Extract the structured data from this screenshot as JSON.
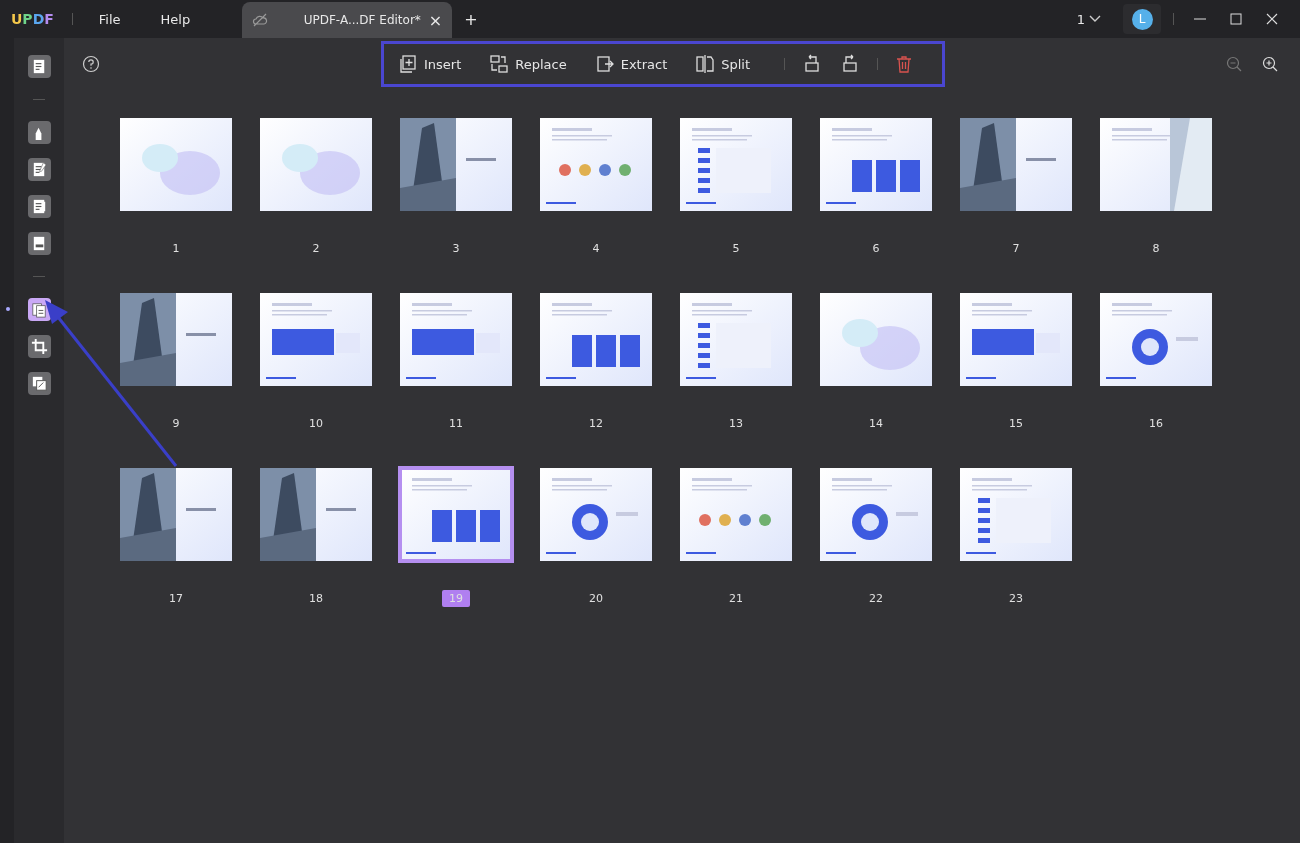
{
  "app": {
    "logo": "UPDF",
    "menu": [
      "File",
      "Help"
    ]
  },
  "tab": {
    "title": "UPDF-A...DF Editor*",
    "close": "×",
    "add": "+"
  },
  "window_controls": {
    "page_count": "1",
    "avatar": "L"
  },
  "sidebar": {
    "groups": [
      [
        {
          "kind": "reader",
          "selected": false
        }
      ],
      [
        {
          "kind": "comment",
          "selected": false
        },
        {
          "kind": "edit",
          "selected": false
        },
        {
          "kind": "form",
          "selected": false
        },
        {
          "kind": "fill",
          "selected": false
        }
      ],
      [
        {
          "kind": "organize",
          "selected": true
        },
        {
          "kind": "crop",
          "selected": false
        },
        {
          "kind": "watermark",
          "selected": false
        }
      ]
    ]
  },
  "toolbar": {
    "actions": [
      {
        "kind": "insert",
        "label": "Insert"
      },
      {
        "kind": "replace",
        "label": "Replace"
      },
      {
        "kind": "extract",
        "label": "Extract"
      },
      {
        "kind": "split",
        "label": "Split"
      }
    ],
    "icons": [
      {
        "kind": "rotate-left"
      },
      {
        "kind": "rotate-right"
      },
      {
        "kind": "delete"
      }
    ]
  },
  "pages": [
    {
      "label": "1",
      "kind": "gradient",
      "selected": false
    },
    {
      "label": "2",
      "kind": "gradient",
      "selected": false
    },
    {
      "label": "3",
      "kind": "building",
      "selected": false
    },
    {
      "label": "4",
      "kind": "icons",
      "selected": false
    },
    {
      "label": "5",
      "kind": "list",
      "selected": false
    },
    {
      "label": "6",
      "kind": "cards",
      "selected": false
    },
    {
      "label": "7",
      "kind": "building",
      "selected": false
    },
    {
      "label": "8",
      "kind": "building-right",
      "selected": false
    },
    {
      "label": "9",
      "kind": "building",
      "selected": false
    },
    {
      "label": "10",
      "kind": "panel",
      "selected": false
    },
    {
      "label": "11",
      "kind": "panel",
      "selected": false
    },
    {
      "label": "12",
      "kind": "cards",
      "selected": false
    },
    {
      "label": "13",
      "kind": "list",
      "selected": false
    },
    {
      "label": "14",
      "kind": "gradient",
      "selected": false
    },
    {
      "label": "15",
      "kind": "panel",
      "selected": false
    },
    {
      "label": "16",
      "kind": "circle",
      "selected": false
    },
    {
      "label": "17",
      "kind": "building",
      "selected": false
    },
    {
      "label": "18",
      "kind": "building",
      "selected": false
    },
    {
      "label": "19",
      "kind": "cards",
      "selected": true
    },
    {
      "label": "20",
      "kind": "circle",
      "selected": false
    },
    {
      "label": "21",
      "kind": "icons",
      "selected": false
    },
    {
      "label": "22",
      "kind": "circle",
      "selected": false
    },
    {
      "label": "23",
      "kind": "list",
      "selected": false
    }
  ]
}
